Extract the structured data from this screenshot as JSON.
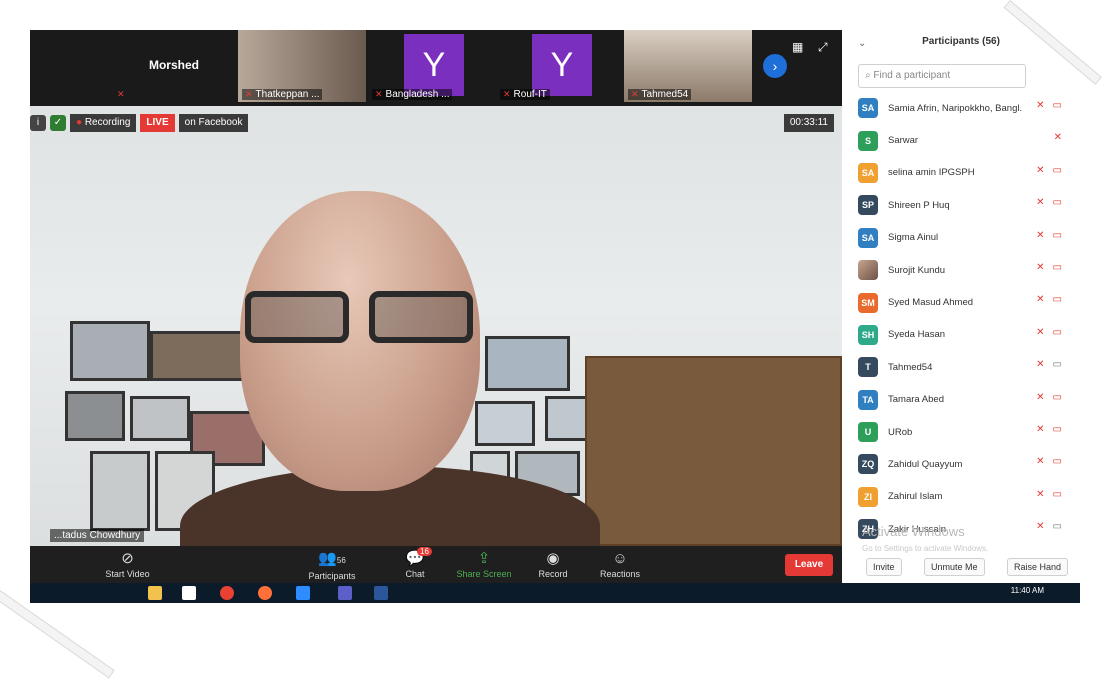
{
  "meeting": {
    "top_strip": {
      "tiles": [
        {
          "label": "Morshed"
        },
        {
          "caption": "Thatkeppan ..."
        },
        {
          "avatar_letter": "Y",
          "caption": "Bangladesh ..."
        },
        {
          "avatar_letter": "Y",
          "caption": "Rouf-IT"
        },
        {
          "caption": "Tahmed54"
        }
      ]
    },
    "status": {
      "recording_label": "Recording",
      "live_label": "LIVE",
      "live_target": "on Facebook",
      "timer": "00:33:11"
    },
    "speaker_name": "...tadus Chowdhury",
    "controls": {
      "start_video": "Start Video",
      "participants": "Participants",
      "participants_count": "56",
      "chat": "Chat",
      "chat_badge": "16",
      "share_screen": "Share Screen",
      "record": "Record",
      "reactions": "Reactions",
      "leave": "Leave"
    }
  },
  "participants_panel": {
    "title": "Participants (56)",
    "search_placeholder": "Find a participant",
    "items": [
      {
        "initials": "SA",
        "name": "Samia Afrin, Naripokkho, Bangl...",
        "color": "#2f7fc1"
      },
      {
        "initials": "S",
        "name": "Sarwar",
        "color": "#2e9e5b"
      },
      {
        "initials": "SA",
        "name": "selina amin IPGSPH",
        "color": "#f0a030"
      },
      {
        "initials": "SP",
        "name": "Shireen P Huq",
        "color": "#354a5f"
      },
      {
        "initials": "SA",
        "name": "Sigma Ainul",
        "color": "#2f7fc1"
      },
      {
        "initials": "",
        "name": "Surojit Kundu",
        "color": "#8a6b5a"
      },
      {
        "initials": "SM",
        "name": "Syed Masud Ahmed",
        "color": "#e86a2c"
      },
      {
        "initials": "SH",
        "name": "Syeda Hasan",
        "color": "#2eaa8a"
      },
      {
        "initials": "T",
        "name": "Tahmed54",
        "color": "#354a5f"
      },
      {
        "initials": "TA",
        "name": "Tamara Abed",
        "color": "#2f7fc1"
      },
      {
        "initials": "U",
        "name": "URob",
        "color": "#2e9e5b"
      },
      {
        "initials": "ZQ",
        "name": "Zahidul Quayyum",
        "color": "#354a5f"
      },
      {
        "initials": "ZI",
        "name": "Zahirul Islam",
        "color": "#f0a030"
      },
      {
        "initials": "ZH",
        "name": "Zakir Hussain",
        "color": "#354a5f"
      }
    ],
    "footer": {
      "invite": "Invite",
      "unmute_me": "Unmute Me",
      "raise_hand": "Raise Hand"
    },
    "watermark": {
      "line1": "Activate Windows",
      "line2": "Go to Settings to activate Windows."
    }
  },
  "taskbar": {
    "time": "11:40 AM"
  }
}
